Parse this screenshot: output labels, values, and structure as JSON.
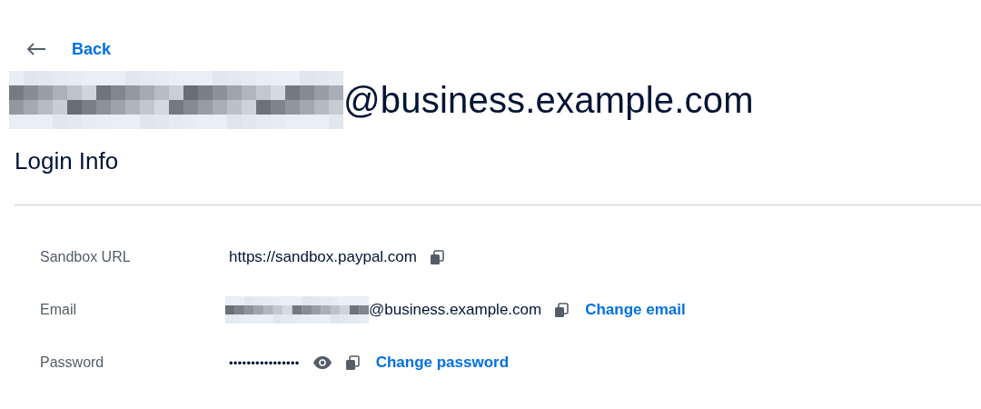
{
  "back_link": {
    "label": "Back"
  },
  "heading": {
    "email_domain": "@business.example.com"
  },
  "section": {
    "title": "Login Info"
  },
  "rows": [
    {
      "kind": "url",
      "label": "Sandbox URL",
      "value": "https://sandbox.paypal.com"
    },
    {
      "kind": "email",
      "label": "Email",
      "value": "@business.example.com",
      "action": "Change email"
    },
    {
      "kind": "password",
      "label": "Password",
      "value": "••••••••••••••••",
      "action": "Change password"
    }
  ]
}
